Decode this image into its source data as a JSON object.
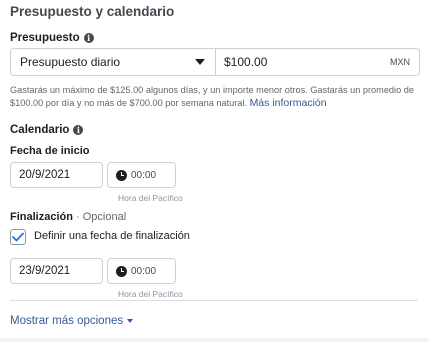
{
  "section_title": "Presupuesto y calendario",
  "budget": {
    "label": "Presupuesto",
    "type_value": "Presupuesto diario",
    "amount_value": "$100.00",
    "currency": "MXN",
    "help_text": "Gastarás un máximo de $125.00 algunos días, y un importe menor otros. Gastarás un promedio de $100.00 por día y no más de $700.00 por semana natural.",
    "help_link": "Más información"
  },
  "schedule": {
    "label": "Calendario",
    "start": {
      "label": "Fecha de inicio",
      "date": "20/9/2021",
      "time": "00:00",
      "timezone": "Hora del Pacífico"
    },
    "end": {
      "label": "Finalización",
      "optional": "· Opcional",
      "checkbox_label": "Definir una fecha de finalización",
      "checked": true,
      "date": "23/9/2021",
      "time": "00:00",
      "timezone": "Hora del Pacífico"
    }
  },
  "more_options": "Mostrar más opciones",
  "colors": {
    "link": "#385898",
    "check": "#1877f2"
  }
}
